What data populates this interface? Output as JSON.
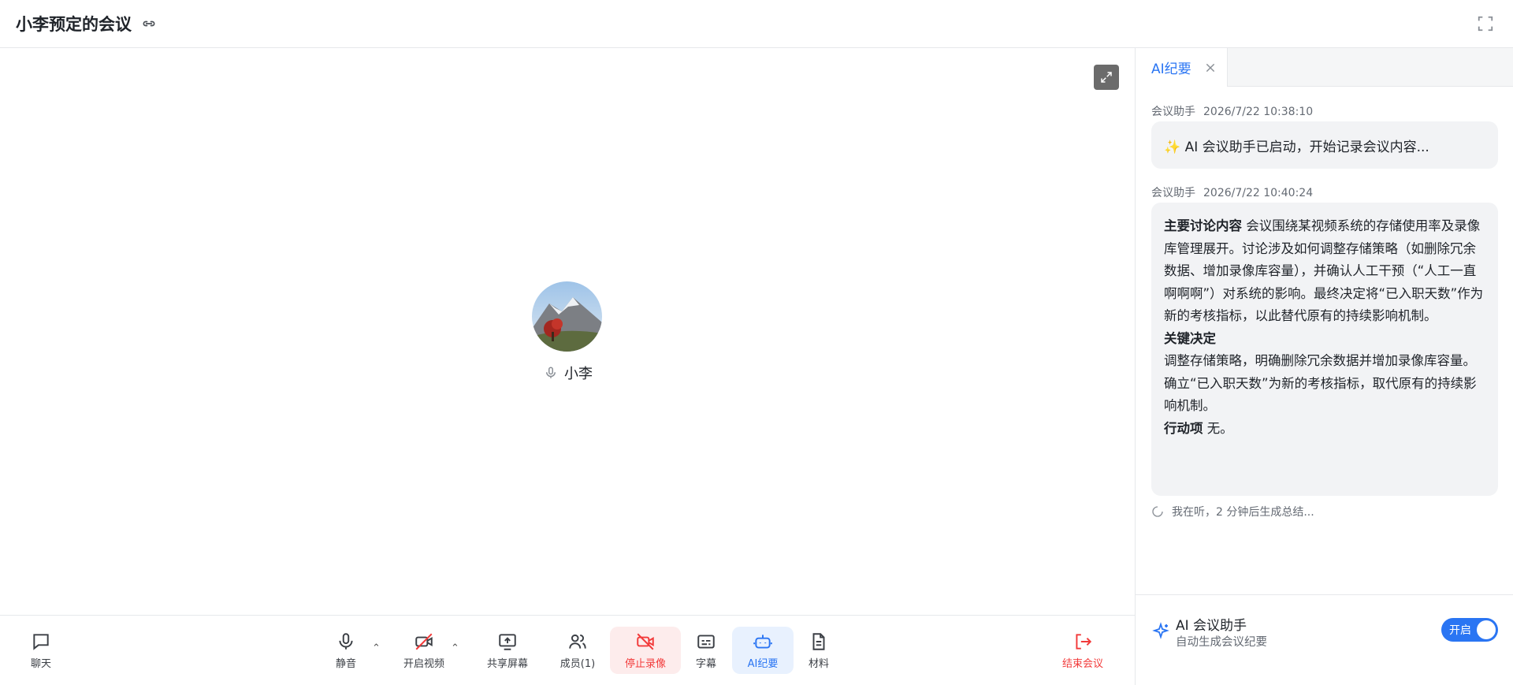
{
  "header": {
    "title": "小李预定的会议"
  },
  "stage": {
    "participant_name": "小李"
  },
  "toolbar": {
    "chat": "聊天",
    "mute": "静音",
    "video": "开启视频",
    "share": "共享屏幕",
    "members": "成员(1)",
    "stop_recording": "停止录像",
    "subtitles": "字幕",
    "ai_summary": "AI纪要",
    "materials": "材料",
    "end_meeting": "结束会议",
    "caret": "⌃"
  },
  "panel": {
    "tab_label": "AI纪要",
    "messages": [
      {
        "sender": "会议助手",
        "time": "2026/7/22 10:38:10",
        "text": "✨ AI 会议助手已启动，开始记录会议内容..."
      },
      {
        "sender": "会议助手",
        "time": "2026/7/22 10:40:24",
        "sections": {
          "main_title": "主要讨论内容",
          "main_text": "会议围绕某视频系统的存储使用率及录像库管理展开。讨论涉及如何调整存储策略（如删除冗余数据、增加录像库容量），并确认人工干预（“人工一直啊啊啊”）对系统的影响。最终决定将“已入职天数”作为新的考核指标，以此替代原有的持续影响机制。",
          "decision_title": "关键决定",
          "decision_1": "调整存储策略，明确删除冗余数据并增加录像库容量。",
          "decision_2": "确立“已入职天数”为新的考核指标，取代原有的持续影响机制。",
          "action_title": "行动项",
          "action_text": "无。"
        }
      }
    ],
    "listening": "我在听，2 分钟后生成总结...",
    "assistant": {
      "title": "AI 会议助手",
      "subtitle": "自动生成会议纪要",
      "toggle_label": "开启"
    }
  },
  "colors": {
    "accent": "#2a75f3",
    "danger": "#f23a3a"
  }
}
